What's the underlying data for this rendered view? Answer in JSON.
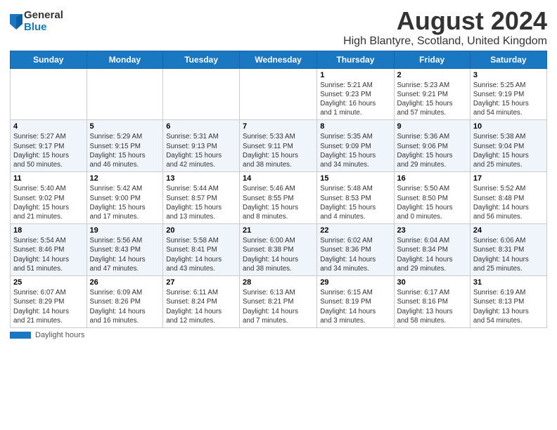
{
  "header": {
    "logo_general": "General",
    "logo_blue": "Blue",
    "month_title": "August 2024",
    "location": "High Blantyre, Scotland, United Kingdom"
  },
  "days_of_week": [
    "Sunday",
    "Monday",
    "Tuesday",
    "Wednesday",
    "Thursday",
    "Friday",
    "Saturday"
  ],
  "footer": {
    "label": "Daylight hours"
  },
  "weeks": [
    [
      {
        "day": "",
        "info": ""
      },
      {
        "day": "",
        "info": ""
      },
      {
        "day": "",
        "info": ""
      },
      {
        "day": "",
        "info": ""
      },
      {
        "day": "1",
        "info": "Sunrise: 5:21 AM\nSunset: 9:23 PM\nDaylight: 16 hours\nand 1 minute."
      },
      {
        "day": "2",
        "info": "Sunrise: 5:23 AM\nSunset: 9:21 PM\nDaylight: 15 hours\nand 57 minutes."
      },
      {
        "day": "3",
        "info": "Sunrise: 5:25 AM\nSunset: 9:19 PM\nDaylight: 15 hours\nand 54 minutes."
      }
    ],
    [
      {
        "day": "4",
        "info": "Sunrise: 5:27 AM\nSunset: 9:17 PM\nDaylight: 15 hours\nand 50 minutes."
      },
      {
        "day": "5",
        "info": "Sunrise: 5:29 AM\nSunset: 9:15 PM\nDaylight: 15 hours\nand 46 minutes."
      },
      {
        "day": "6",
        "info": "Sunrise: 5:31 AM\nSunset: 9:13 PM\nDaylight: 15 hours\nand 42 minutes."
      },
      {
        "day": "7",
        "info": "Sunrise: 5:33 AM\nSunset: 9:11 PM\nDaylight: 15 hours\nand 38 minutes."
      },
      {
        "day": "8",
        "info": "Sunrise: 5:35 AM\nSunset: 9:09 PM\nDaylight: 15 hours\nand 34 minutes."
      },
      {
        "day": "9",
        "info": "Sunrise: 5:36 AM\nSunset: 9:06 PM\nDaylight: 15 hours\nand 29 minutes."
      },
      {
        "day": "10",
        "info": "Sunrise: 5:38 AM\nSunset: 9:04 PM\nDaylight: 15 hours\nand 25 minutes."
      }
    ],
    [
      {
        "day": "11",
        "info": "Sunrise: 5:40 AM\nSunset: 9:02 PM\nDaylight: 15 hours\nand 21 minutes."
      },
      {
        "day": "12",
        "info": "Sunrise: 5:42 AM\nSunset: 9:00 PM\nDaylight: 15 hours\nand 17 minutes."
      },
      {
        "day": "13",
        "info": "Sunrise: 5:44 AM\nSunset: 8:57 PM\nDaylight: 15 hours\nand 13 minutes."
      },
      {
        "day": "14",
        "info": "Sunrise: 5:46 AM\nSunset: 8:55 PM\nDaylight: 15 hours\nand 8 minutes."
      },
      {
        "day": "15",
        "info": "Sunrise: 5:48 AM\nSunset: 8:53 PM\nDaylight: 15 hours\nand 4 minutes."
      },
      {
        "day": "16",
        "info": "Sunrise: 5:50 AM\nSunset: 8:50 PM\nDaylight: 15 hours\nand 0 minutes."
      },
      {
        "day": "17",
        "info": "Sunrise: 5:52 AM\nSunset: 8:48 PM\nDaylight: 14 hours\nand 56 minutes."
      }
    ],
    [
      {
        "day": "18",
        "info": "Sunrise: 5:54 AM\nSunset: 8:46 PM\nDaylight: 14 hours\nand 51 minutes."
      },
      {
        "day": "19",
        "info": "Sunrise: 5:56 AM\nSunset: 8:43 PM\nDaylight: 14 hours\nand 47 minutes."
      },
      {
        "day": "20",
        "info": "Sunrise: 5:58 AM\nSunset: 8:41 PM\nDaylight: 14 hours\nand 43 minutes."
      },
      {
        "day": "21",
        "info": "Sunrise: 6:00 AM\nSunset: 8:38 PM\nDaylight: 14 hours\nand 38 minutes."
      },
      {
        "day": "22",
        "info": "Sunrise: 6:02 AM\nSunset: 8:36 PM\nDaylight: 14 hours\nand 34 minutes."
      },
      {
        "day": "23",
        "info": "Sunrise: 6:04 AM\nSunset: 8:34 PM\nDaylight: 14 hours\nand 29 minutes."
      },
      {
        "day": "24",
        "info": "Sunrise: 6:06 AM\nSunset: 8:31 PM\nDaylight: 14 hours\nand 25 minutes."
      }
    ],
    [
      {
        "day": "25",
        "info": "Sunrise: 6:07 AM\nSunset: 8:29 PM\nDaylight: 14 hours\nand 21 minutes."
      },
      {
        "day": "26",
        "info": "Sunrise: 6:09 AM\nSunset: 8:26 PM\nDaylight: 14 hours\nand 16 minutes."
      },
      {
        "day": "27",
        "info": "Sunrise: 6:11 AM\nSunset: 8:24 PM\nDaylight: 14 hours\nand 12 minutes."
      },
      {
        "day": "28",
        "info": "Sunrise: 6:13 AM\nSunset: 8:21 PM\nDaylight: 14 hours\nand 7 minutes."
      },
      {
        "day": "29",
        "info": "Sunrise: 6:15 AM\nSunset: 8:19 PM\nDaylight: 14 hours\nand 3 minutes."
      },
      {
        "day": "30",
        "info": "Sunrise: 6:17 AM\nSunset: 8:16 PM\nDaylight: 13 hours\nand 58 minutes."
      },
      {
        "day": "31",
        "info": "Sunrise: 6:19 AM\nSunset: 8:13 PM\nDaylight: 13 hours\nand 54 minutes."
      }
    ]
  ]
}
